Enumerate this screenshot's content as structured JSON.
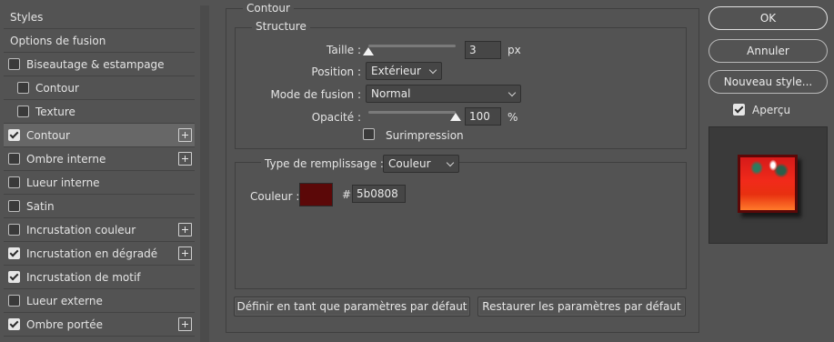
{
  "left_list": {
    "items": [
      {
        "label": "Styles",
        "kind": "header",
        "checked": false,
        "plus": false
      },
      {
        "label": "Options de fusion",
        "kind": "header",
        "checked": false,
        "plus": false
      },
      {
        "label": "Biseautage & estampage",
        "kind": "item",
        "checked": false,
        "plus": false
      },
      {
        "label": "Contour",
        "kind": "sub",
        "checked": false,
        "plus": false
      },
      {
        "label": "Texture",
        "kind": "sub",
        "checked": false,
        "plus": false
      },
      {
        "label": "Contour",
        "kind": "item",
        "checked": true,
        "plus": true,
        "selected": true
      },
      {
        "label": "Ombre interne",
        "kind": "item",
        "checked": false,
        "plus": true
      },
      {
        "label": "Lueur interne",
        "kind": "item",
        "checked": false,
        "plus": false
      },
      {
        "label": "Satin",
        "kind": "item",
        "checked": false,
        "plus": false
      },
      {
        "label": "Incrustation couleur",
        "kind": "item",
        "checked": false,
        "plus": true
      },
      {
        "label": "Incrustation en dégradé",
        "kind": "item",
        "checked": true,
        "plus": true
      },
      {
        "label": "Incrustation de motif",
        "kind": "item",
        "checked": true,
        "plus": false
      },
      {
        "label": "Lueur externe",
        "kind": "item",
        "checked": false,
        "plus": false
      },
      {
        "label": "Ombre portée",
        "kind": "item",
        "checked": true,
        "plus": true
      }
    ]
  },
  "contour": {
    "section_title": "Contour",
    "structure": {
      "title": "Structure",
      "size_label": "Taille :",
      "size_value": "3",
      "size_unit": "px",
      "size_level_percent": 0,
      "position_label": "Position :",
      "position_value": "Extérieur",
      "blend_label": "Mode de fusion :",
      "blend_value": "Normal",
      "opacity_label": "Opacité :",
      "opacity_value": "100",
      "opacity_unit": "%",
      "opacity_level_percent": 100,
      "overprint_label": "Surimpression",
      "overprint_checked": false
    },
    "fill": {
      "type_label": "Type de remplissage :",
      "type_value": "Couleur",
      "color_label": "Couleur :",
      "hash": "#",
      "hex_value": "5b0808",
      "swatch_color": "#5b0808"
    },
    "buttons": {
      "make_default": "Définir en tant que paramètres par défaut",
      "reset_default": "Restaurer les paramètres par défaut"
    }
  },
  "dialog_buttons": {
    "ok": "OK",
    "cancel": "Annuler",
    "new_style": "Nouveau style...",
    "preview_label": "Aperçu",
    "preview_checked": true
  }
}
